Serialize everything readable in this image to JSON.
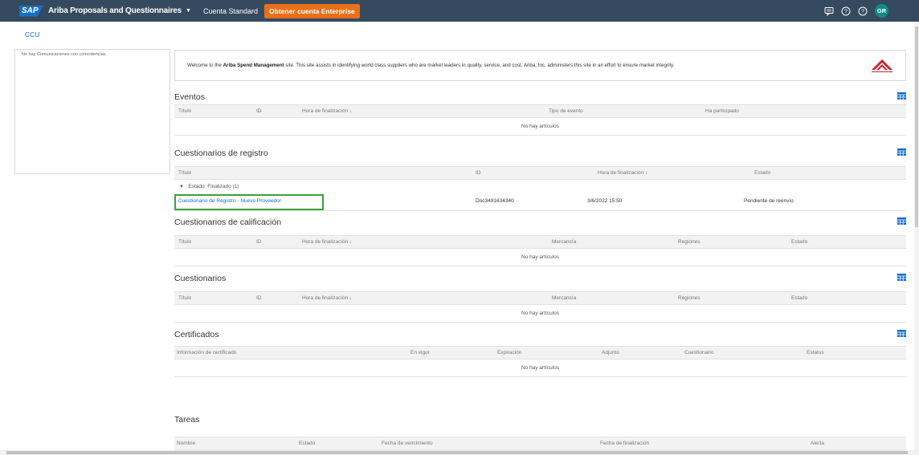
{
  "topbar": {
    "logo": "SAP",
    "app_title": "Ariba Proposals and Questionnaires",
    "account_label": "Cuenta Standard",
    "enterprise_button": "Obtener cuenta Enterprise",
    "avatar_initials": "GR"
  },
  "breadcrumb": {
    "ccu": "CCU"
  },
  "left_panel": {
    "empty_text": "No hay Comunicaciones con coincidencias."
  },
  "welcome": {
    "prefix": "Welcome to the ",
    "bold": "Ariba Spend Management",
    "suffix": " site.  This site assists in identifying world class suppliers who are market leaders in quality, service, and cost. Ariba, Inc. administers this site in an effort to ensure market integrity."
  },
  "eventos": {
    "title": "Eventos",
    "columns": [
      "Título",
      "ID",
      "Hora de finalización ↓",
      "Tipo de evento",
      "Ha participado"
    ],
    "empty": "No hay artículos"
  },
  "registro": {
    "title": "Cuestionarios de registro",
    "columns": [
      "Título",
      "ID",
      "Hora de finalización ↓",
      "Estado"
    ],
    "group": "Estado: Finalizado  (1)",
    "rows": [
      {
        "titulo": "Cuestionario de Registro - Nuevo Proveedor",
        "id": "Doc3491634340",
        "hora": "3/6/2022 15:50",
        "estado": "Pendiente de reenvío"
      }
    ]
  },
  "calificacion": {
    "title": "Cuestionarios de calificación",
    "columns": [
      "Título",
      "ID",
      "Hora de finalización ↓",
      "Mercancía",
      "Regiones",
      "Estado"
    ],
    "empty": "No hay artículos"
  },
  "cuestionarios": {
    "title": "Cuestionarios",
    "columns": [
      "Título",
      "ID",
      "Hora de finalización ↓",
      "Mercancía",
      "Regiones",
      "Estado"
    ],
    "empty": "No hay artículos"
  },
  "certificados": {
    "title": "Certificados",
    "columns": [
      "Información de certificado",
      "En vigor",
      "Expiración",
      "Adjunto",
      "Cuestionario",
      "Estatus"
    ],
    "empty": "No hay artículos"
  },
  "tareas": {
    "title": "Tareas",
    "columns": [
      "Nombre",
      "Estado",
      "Fecha de vencimiento",
      "Fecha de finalización",
      "Alerta"
    ]
  },
  "icons": [
    "notifications-icon",
    "help-icon",
    "help-icon",
    "grid-settings-icon",
    "ariba-logo"
  ],
  "colors": {
    "header": "#354a5f",
    "accent": "#e8701a",
    "link": "#0a6ed1",
    "highlight": "#3aa13a"
  }
}
